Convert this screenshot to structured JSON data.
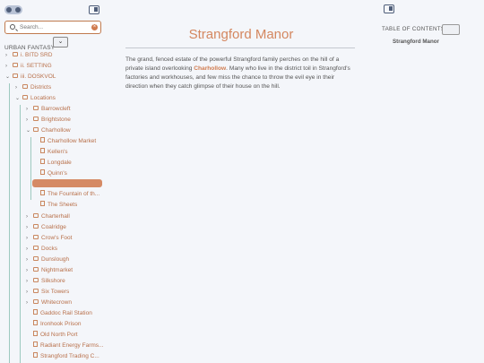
{
  "sidebar": {
    "search": {
      "placeholder": "Search...",
      "value": ""
    },
    "vault_name": "URBAN FANTASY",
    "tree": [
      {
        "label": "i. BITD SRD",
        "type": "folder",
        "expanded": false
      },
      {
        "label": "ii. SETTING",
        "type": "folder",
        "expanded": false
      },
      {
        "label": "iii. DOSKVOL",
        "type": "folder",
        "expanded": true
      },
      {
        "label": "Districts",
        "type": "folder",
        "expanded": false
      },
      {
        "label": "Locations",
        "type": "folder",
        "expanded": true
      },
      {
        "label": "Barrowcleft",
        "type": "folder",
        "expanded": false
      },
      {
        "label": "Brightstone",
        "type": "folder",
        "expanded": false
      },
      {
        "label": "Charhollow",
        "type": "folder",
        "expanded": true
      },
      {
        "label": "Charhollow Market",
        "type": "file"
      },
      {
        "label": "Kellen's",
        "type": "file"
      },
      {
        "label": "Longdale",
        "type": "file"
      },
      {
        "label": "Quinn's",
        "type": "file"
      },
      {
        "label": "",
        "type": "file",
        "selected": true
      },
      {
        "label": "The Fountain of th...",
        "type": "file"
      },
      {
        "label": "The Sheets",
        "type": "file"
      },
      {
        "label": "Charterhall",
        "type": "folder",
        "expanded": false
      },
      {
        "label": "Coalridge",
        "type": "folder",
        "expanded": false
      },
      {
        "label": "Crow's Foot",
        "type": "folder",
        "expanded": false
      },
      {
        "label": "Docks",
        "type": "folder",
        "expanded": false
      },
      {
        "label": "Dunslough",
        "type": "folder",
        "expanded": false
      },
      {
        "label": "Nightmarket",
        "type": "folder",
        "expanded": false
      },
      {
        "label": "Silkshore",
        "type": "folder",
        "expanded": false
      },
      {
        "label": "Six Towers",
        "type": "folder",
        "expanded": false
      },
      {
        "label": "Whitecrown",
        "type": "folder",
        "expanded": false
      },
      {
        "label": "Gaddoc Rail Station",
        "type": "file"
      },
      {
        "label": "Ironhook Prison",
        "type": "file"
      },
      {
        "label": "Old North Port",
        "type": "file"
      },
      {
        "label": "Radiant Energy Farms...",
        "type": "file"
      },
      {
        "label": "Strangford Trading C...",
        "type": "file"
      }
    ]
  },
  "main": {
    "title": "Strangford Manor",
    "paragraph_before": "The grand, fenced estate of the powerful Strangford family perches on the hill of a private island overlooking ",
    "paragraph_link": "Charhollow",
    "paragraph_after": ". Many who live in the district toil in Strangford's factories and workhouses, and few miss the chance to throw the evil eye in their direction when they catch glimpse of their house on the hill."
  },
  "toc": {
    "label": "TABLE OF CONTENTS",
    "items": [
      "Strangford Manor"
    ]
  },
  "colors": {
    "accent": "#d4875f",
    "link": "#d07b4f",
    "selected_row": "#d58a65",
    "tree_line": "#9dc9bf"
  },
  "icons": {
    "toggle": "theme-toggle-icon",
    "left_panel": "sidebar-panel-icon",
    "right_panel": "toc-panel-icon",
    "search": "search-icon",
    "clear": "clear-icon",
    "collapse": "collapse-all-icon"
  }
}
